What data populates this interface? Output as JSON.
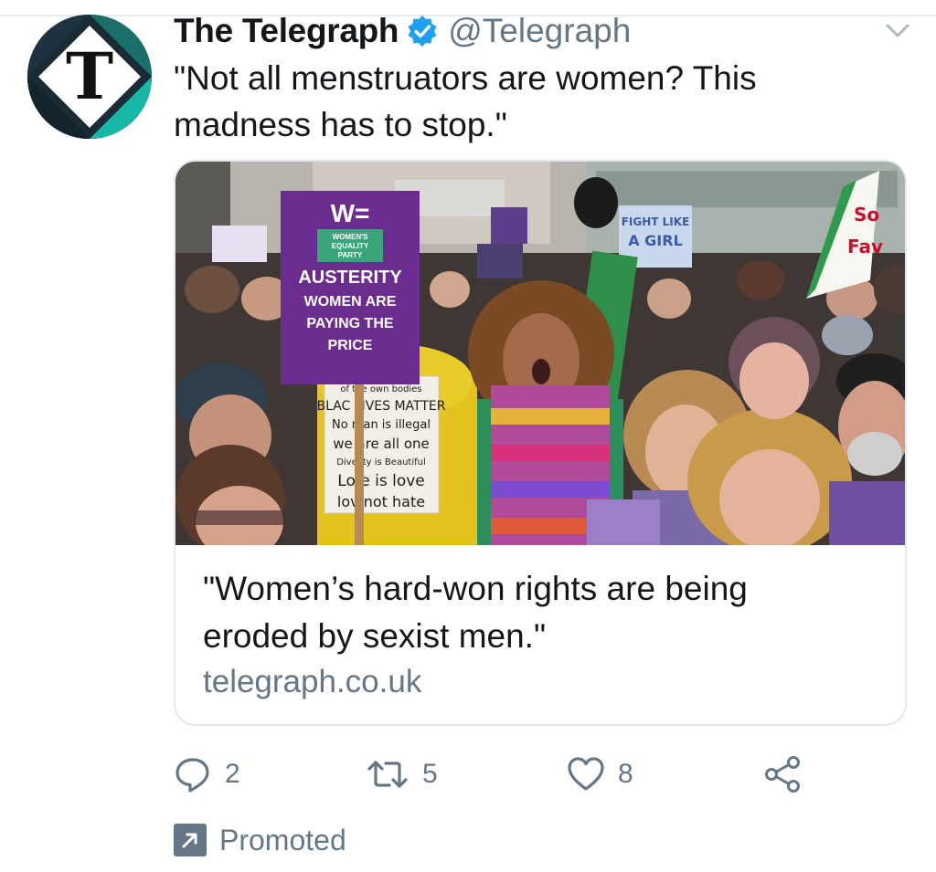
{
  "tweet": {
    "author": {
      "display_name": "The Telegraph",
      "handle": "@Telegraph",
      "verified": true,
      "avatar_icon": "telegraph-t-logo",
      "avatar_letter": "T"
    },
    "text_line1": "\"Not all menstruators are women? This",
    "text_line2": "madness has to stop.\"",
    "card": {
      "image_description_icon": "protest-photo",
      "sign": {
        "logo_letter": "W=",
        "party_line1": "WOMEN'S",
        "party_line2": "EQUALITY",
        "party_line3": "PARTY",
        "line1": "AUSTERITY",
        "line2": "WOMEN ARE",
        "line3": "PAYING THE",
        "line4": "PRICE"
      },
      "placard": {
        "line1": "of the own bodies",
        "line2": "BLAC LIVES MATTER",
        "line3": "No  man is illegal",
        "line4": "we  are all one",
        "line5": "Dive  ity is Beautiful",
        "line6": "Lo  e is love",
        "line7": "lov  not hate"
      },
      "small_sign": {
        "line1": "FIGHT LIKE",
        "line2": "A GIRL"
      },
      "title_line1": "\"Women’s hard-won rights are being",
      "title_line2": "eroded by sexist men.\"",
      "domain": "telegraph.co.uk"
    },
    "actions": {
      "reply_count": "2",
      "retweet_count": "5",
      "like_count": "8"
    },
    "promoted_label": "Promoted"
  },
  "colors": {
    "verified_blue": "#1da1f2",
    "secondary_text": "#657786",
    "avatar_teal": "#17b8a6",
    "sign_purple": "#6a2c8f"
  }
}
